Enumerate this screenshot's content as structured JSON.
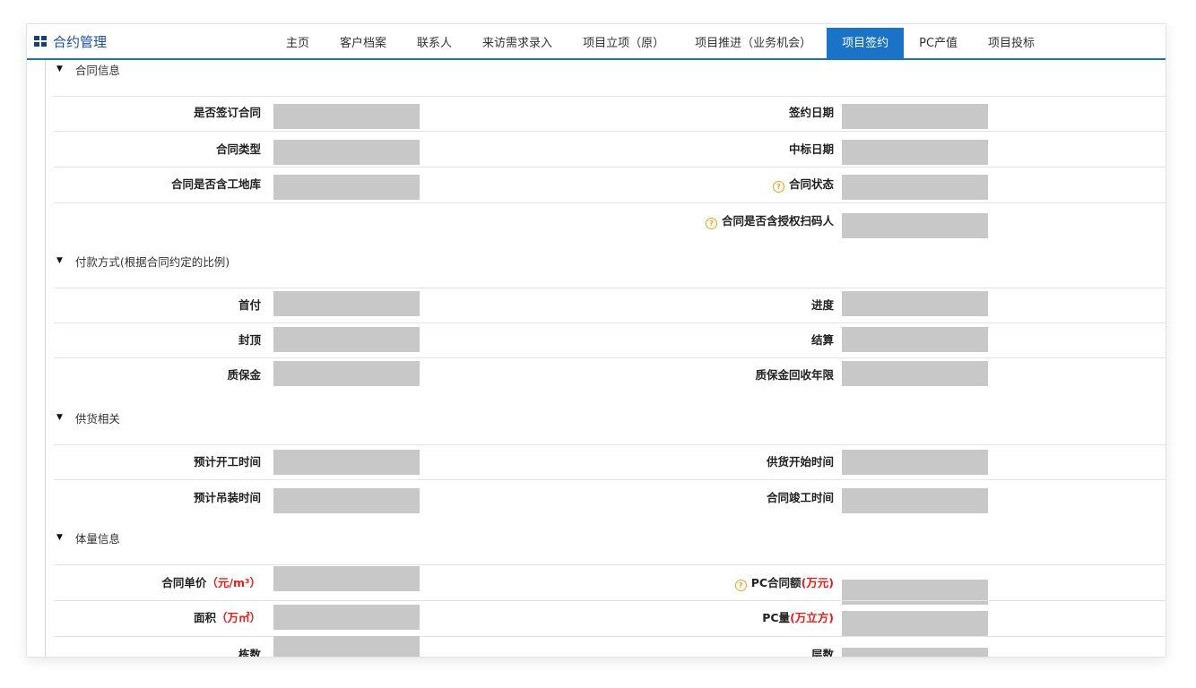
{
  "app": {
    "title": "合约管理"
  },
  "tabs": [
    {
      "label": "主页"
    },
    {
      "label": "客户档案"
    },
    {
      "label": "联系人"
    },
    {
      "label": "来访需求录入"
    },
    {
      "label": "项目立项（原）"
    },
    {
      "label": "项目推进（业务机会）"
    },
    {
      "label": "项目签约",
      "active": true
    },
    {
      "label": "PC产值"
    },
    {
      "label": "项目投标"
    }
  ],
  "sections": {
    "contract": {
      "title": "合同信息",
      "is_signed": "是否签订合同",
      "sign_date": "签约日期",
      "contract_type": "合同类型",
      "bid_date": "中标日期",
      "includes_site_storage": "合同是否含工地库",
      "contract_status": "合同状态",
      "includes_auth_scanner": "合同是否含授权扫码人"
    },
    "payment": {
      "title": "付款方式(根据合同约定的比例)",
      "down_payment": "首付",
      "progress": "进度",
      "topping_out": "封顶",
      "settlement": "结算",
      "warranty": "质保金",
      "warranty_recovery": "质保金回收年限"
    },
    "supply": {
      "title": "供货相关",
      "planned_start": "预计开工时间",
      "supply_start": "供货开始时间",
      "planned_hoisting": "预计吊装时间",
      "contract_completion": "合同竣工时间"
    },
    "volume": {
      "title": "体量信息",
      "unit_price": "合同单价",
      "unit_price_unit": "（元/m³）",
      "pc_amount_prefix": "PC合同额",
      "pc_amount_unit": "(万元)",
      "area": "面积",
      "area_unit": "（万㎡）",
      "pc_volume_prefix": "PC量",
      "pc_volume_unit": "(万立方)",
      "buildings": "栋数",
      "floors": "层数"
    }
  },
  "icons": {
    "app": "grid-icon",
    "help": "question-circle-icon",
    "collapse": "caret-down-icon"
  },
  "colors": {
    "accent": "#1a73c7",
    "unit_red": "#e0201d",
    "help_orange": "#f0a020",
    "field_gray": "#c8c8c9"
  }
}
